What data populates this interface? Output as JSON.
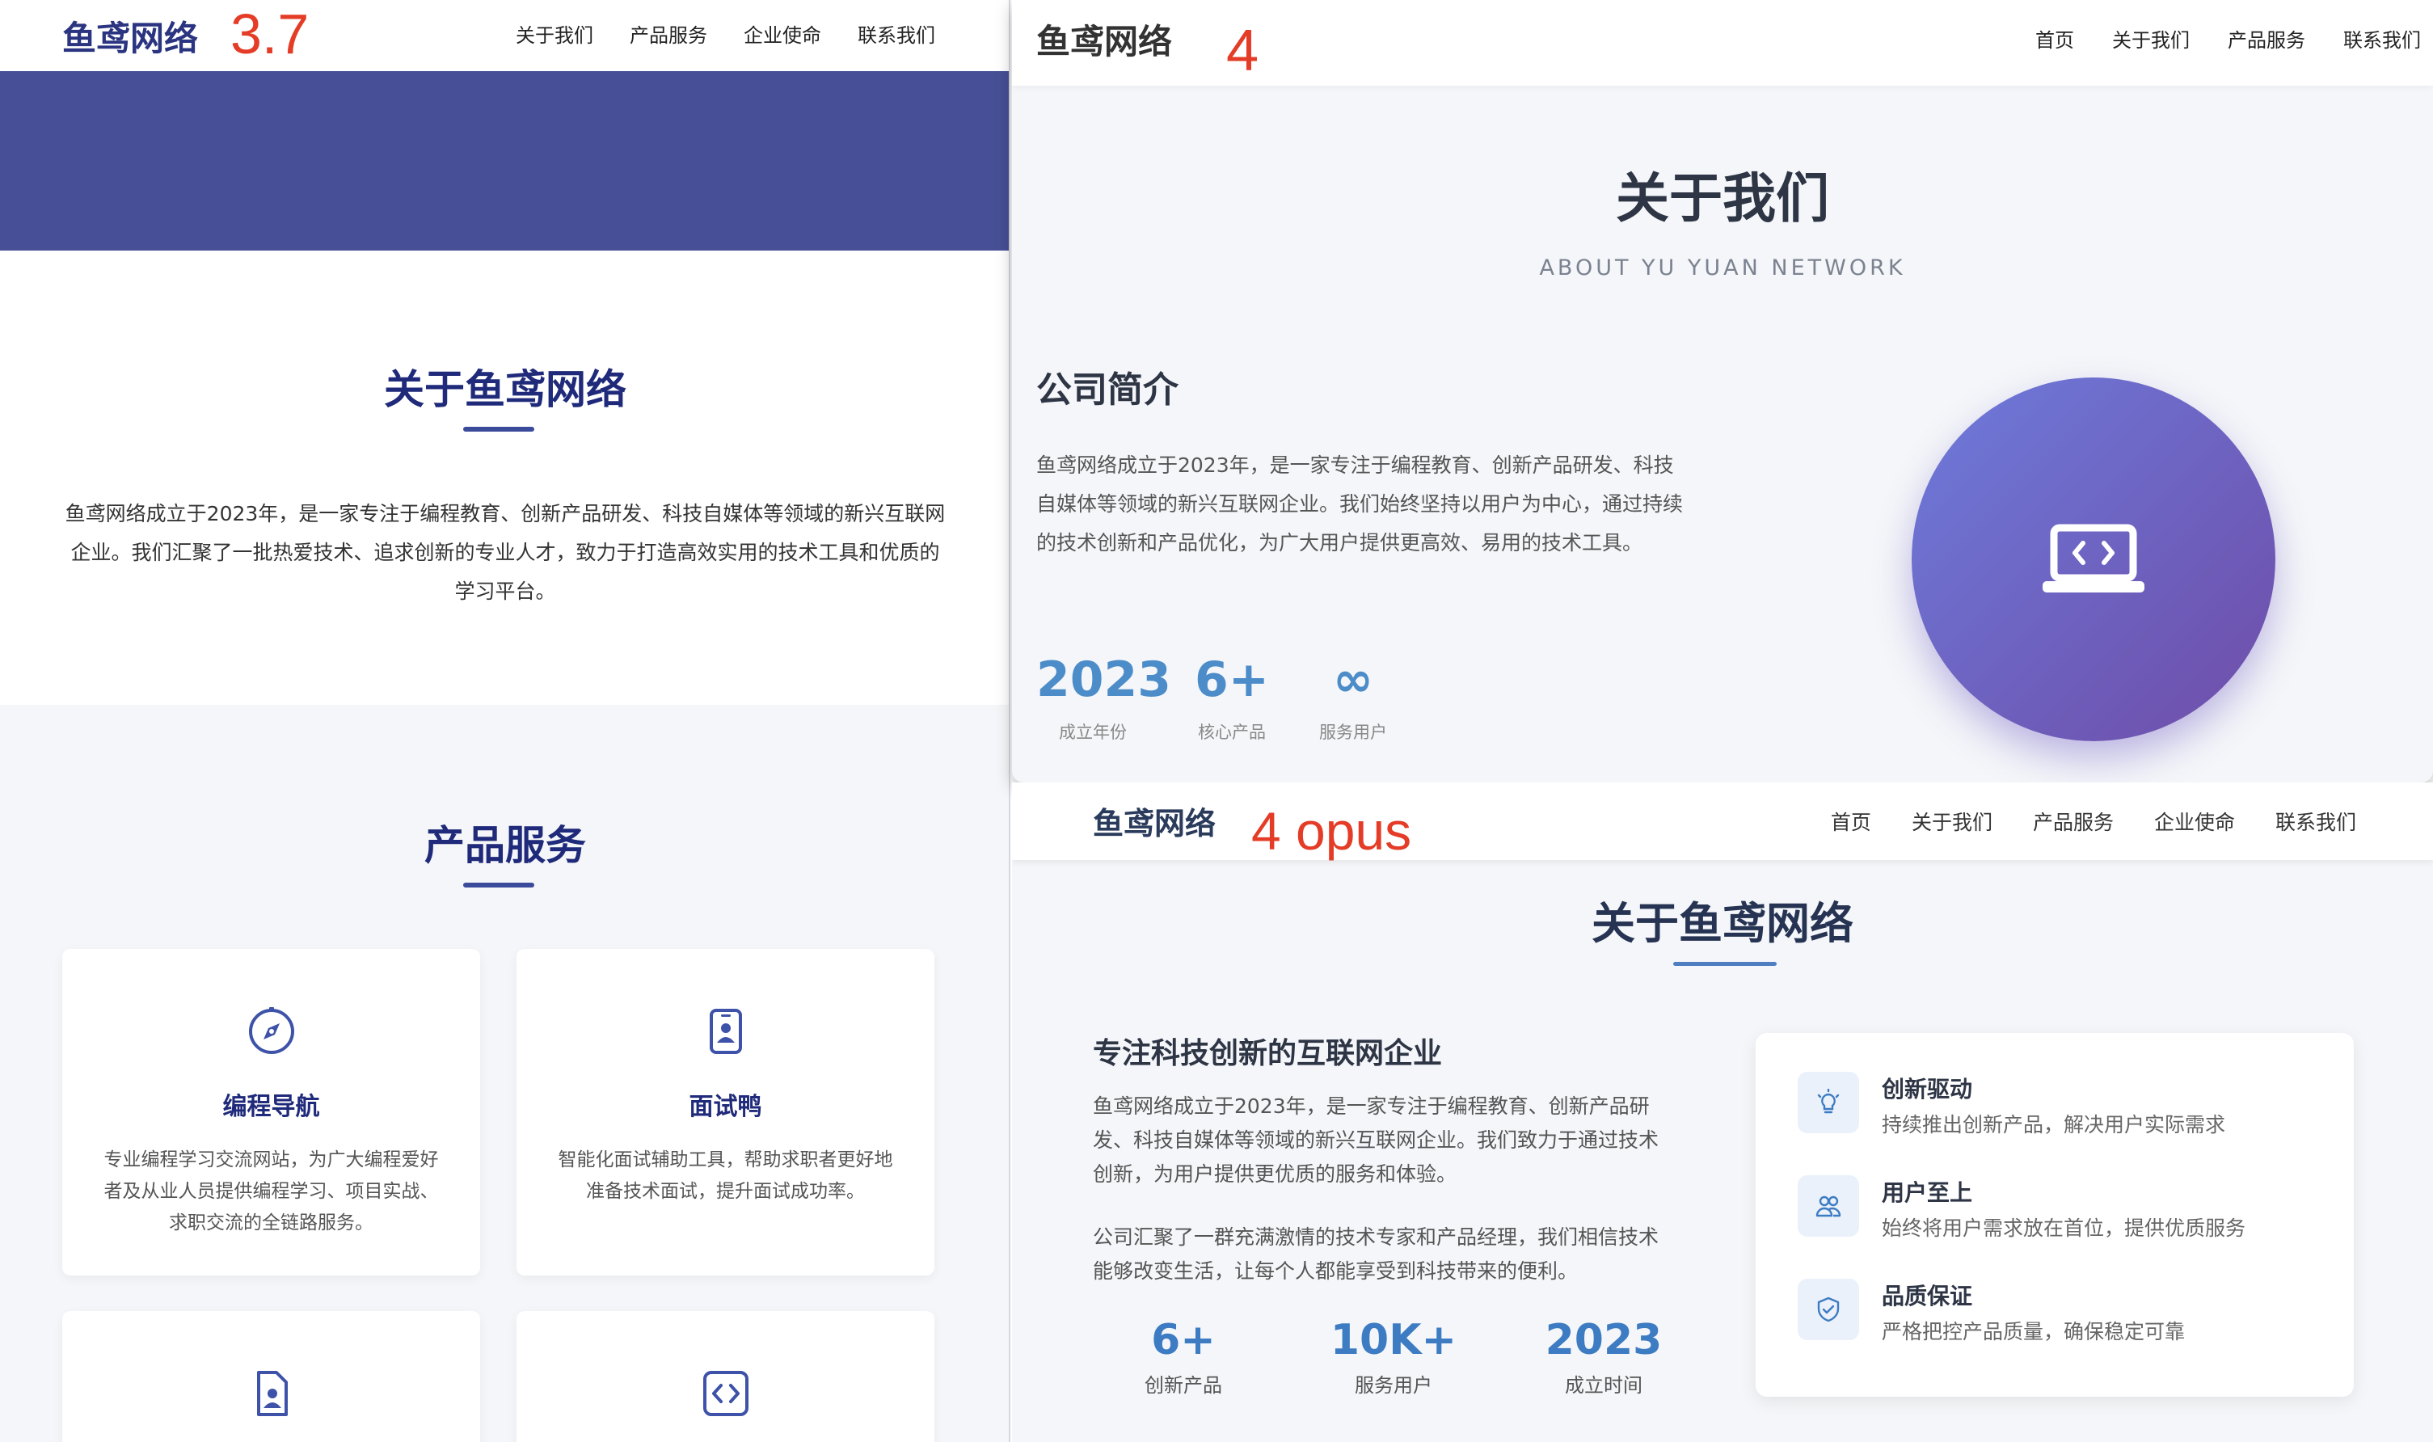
{
  "v37": {
    "logo": "鱼鸢网络",
    "version_label": "3.7",
    "nav": [
      "关于我们",
      "产品服务",
      "企业使命",
      "联系我们"
    ],
    "about_title": "关于鱼鸢网络",
    "about_text": "鱼鸢网络成立于2023年，是一家专注于编程教育、创新产品研发、科技自媒体等领域的新兴互联网企业。我们汇聚了一批热爱技术、追求创新的专业人才，致力于打造高效实用的技术工具和优质的学习平台。",
    "services_title": "产品服务",
    "cards": [
      {
        "icon": "compass-icon",
        "title": "编程导航",
        "desc": "专业编程学习交流网站，为广大编程爱好者及从业人员提供编程学习、项目实战、求职交流的全链路服务。"
      },
      {
        "icon": "id-badge-icon",
        "title": "面试鸭",
        "desc": "智能化面试辅助工具，帮助求职者更好地准备技术面试，提升面试成功率。"
      },
      {
        "icon": "file-user-icon",
        "title": "",
        "desc": ""
      },
      {
        "icon": "code-icon",
        "title": "",
        "desc": ""
      }
    ],
    "colors": {
      "banner": "#474f96",
      "title": "#1f2a7a"
    }
  },
  "v4": {
    "logo": "鱼鸢网络",
    "version_label": "4",
    "nav": [
      "首页",
      "关于我们",
      "产品服务",
      "联系我们"
    ],
    "hero_title": "关于我们",
    "hero_subtitle": "ABOUT YU YUAN NETWORK",
    "section_title": "公司简介",
    "intro": "鱼鸢网络成立于2023年，是一家专注于编程教育、创新产品研发、科技自媒体等领域的新兴互联网企业。我们始终坚持以用户为中心，通过持续的技术创新和产品优化，为广大用户提供更高效、易用的技术工具。",
    "stats": [
      {
        "num": "2023",
        "label": "成立年份"
      },
      {
        "num": "6+",
        "label": "核心产品"
      },
      {
        "num": "∞",
        "label": "服务用户"
      }
    ],
    "circle_icon": "laptop-code-icon",
    "colors": {
      "stat": "#4c8cc9",
      "circle_start": "#6d7bdb",
      "circle_end": "#6f4ca8"
    }
  },
  "v4opus": {
    "logo": "鱼鸢网络",
    "version_label": "4 opus",
    "nav": [
      "首页",
      "关于我们",
      "产品服务",
      "企业使命",
      "联系我们"
    ],
    "hero_title": "关于鱼鸢网络",
    "section_title": "专注科技创新的互联网企业",
    "p1": "鱼鸢网络成立于2023年，是一家专注于编程教育、创新产品研发、科技自媒体等领域的新兴互联网企业。我们致力于通过技术创新，为用户提供更优质的服务和体验。",
    "p2": "公司汇聚了一群充满激情的技术专家和产品经理，我们相信技术能够改变生活，让每个人都能享受到科技带来的便利。",
    "stats": [
      {
        "num": "6+",
        "label": "创新产品"
      },
      {
        "num": "10K+",
        "label": "服务用户"
      },
      {
        "num": "2023",
        "label": "成立时间"
      }
    ],
    "features": [
      {
        "icon": "lightbulb-icon",
        "title": "创新驱动",
        "desc": "持续推出创新产品，解决用户实际需求"
      },
      {
        "icon": "users-icon",
        "title": "用户至上",
        "desc": "始终将用户需求放在首位，提供优质服务"
      },
      {
        "icon": "shield-check-icon",
        "title": "品质保证",
        "desc": "严格把控产品质量，确保稳定可靠"
      }
    ],
    "colors": {
      "stat": "#3d7bc2",
      "underline": "#4f7fc1"
    }
  }
}
